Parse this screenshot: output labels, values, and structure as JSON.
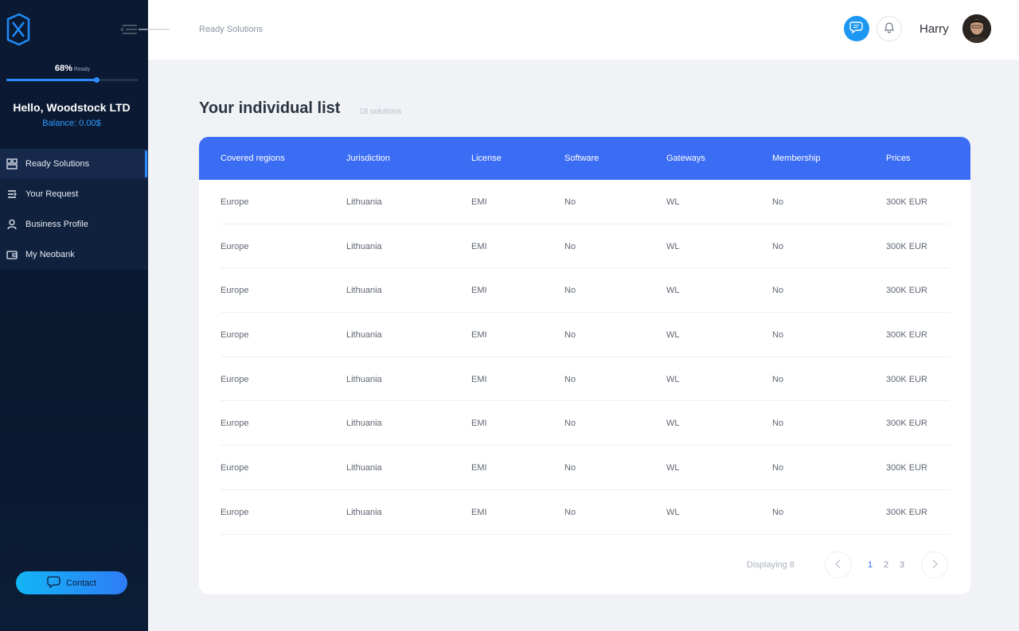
{
  "sidebar": {
    "progress_percent_label": "68%",
    "progress_ready_label": "Ready",
    "progress_value": 0.68,
    "greeting": "Hello, Woodstock LTD",
    "balance": "Balance: 0.00$",
    "items": [
      {
        "label": "Ready Solutions",
        "icon": "solutions-icon",
        "active": true
      },
      {
        "label": "Your Request",
        "icon": "request-icon",
        "active": false
      },
      {
        "label": "Business Profile",
        "icon": "user-icon",
        "active": false
      },
      {
        "label": "My Neobank",
        "icon": "wallet-icon",
        "active": false
      }
    ],
    "contact_label": "Contact"
  },
  "topbar": {
    "breadcrumb": "Ready Solutions",
    "user_name": "Harry"
  },
  "main": {
    "title": "Your individual list",
    "count": "18 solutions",
    "table": {
      "headers": [
        "Covered regions",
        "Jurisdiction",
        "License",
        "Software",
        "Gateways",
        "Membership",
        "Prices"
      ],
      "rows": [
        [
          "Europe",
          "Lithuania",
          "EMI",
          "No",
          "WL",
          "No",
          "300K EUR"
        ],
        [
          "Europe",
          "Lithuania",
          "EMI",
          "No",
          "WL",
          "No",
          "300K EUR"
        ],
        [
          "Europe",
          "Lithuania",
          "EMI",
          "No",
          "WL",
          "No",
          "300K EUR"
        ],
        [
          "Europe",
          "Lithuania",
          "EMI",
          "No",
          "WL",
          "No",
          "300K EUR"
        ],
        [
          "Europe",
          "Lithuania",
          "EMI",
          "No",
          "WL",
          "No",
          "300K EUR"
        ],
        [
          "Europe",
          "Lithuania",
          "EMI",
          "No",
          "WL",
          "No",
          "300K EUR"
        ],
        [
          "Europe",
          "Lithuania",
          "EMI",
          "No",
          "WL",
          "No",
          "300K EUR"
        ],
        [
          "Europe",
          "Lithuania",
          "EMI",
          "No",
          "WL",
          "No",
          "300K EUR"
        ]
      ]
    },
    "pagination": {
      "displaying": "Displaying 8",
      "pages": [
        "1",
        "2",
        "3"
      ],
      "current": "1"
    }
  },
  "colors": {
    "accent": "#3a6cf4",
    "sidebar_bg": "#0b1a33",
    "link_blue": "#2e9bff"
  }
}
